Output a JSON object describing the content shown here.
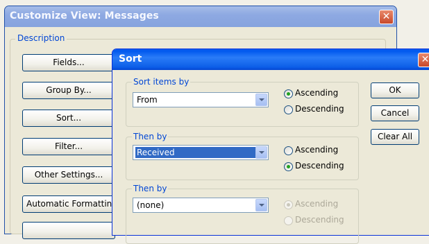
{
  "customize_view": {
    "title": "Customize View: Messages",
    "close_glyph": "✕",
    "description_legend": "Description",
    "buttons": [
      "Fields...",
      "Group By...",
      "Sort...",
      "Filter...",
      "Other Settings...",
      "Automatic Formatting..."
    ]
  },
  "sort_dialog": {
    "title": "Sort",
    "close_glyph": "✕",
    "groups": [
      {
        "legend": "Sort items by",
        "field": "From",
        "ascending_label": "Ascending",
        "descending_label": "Descending",
        "order": "ascending",
        "enabled": true,
        "highlighted": false
      },
      {
        "legend": "Then by",
        "field": "Received",
        "ascending_label": "Ascending",
        "descending_label": "Descending",
        "order": "descending",
        "enabled": true,
        "highlighted": true
      },
      {
        "legend": "Then by",
        "field": "(none)",
        "ascending_label": "Ascending",
        "descending_label": "Descending",
        "order": "ascending",
        "enabled": false,
        "highlighted": false
      }
    ],
    "buttons": {
      "ok": "OK",
      "cancel": "Cancel",
      "clear_all": "Clear All"
    }
  },
  "colors": {
    "xp_title_blue": "#0058ee",
    "inactive_title": "#8ea9e2",
    "dialog_face": "#ece9d8",
    "group_label": "#0046d5",
    "selection": "#316ac5",
    "radio_dot": "#21a121"
  }
}
